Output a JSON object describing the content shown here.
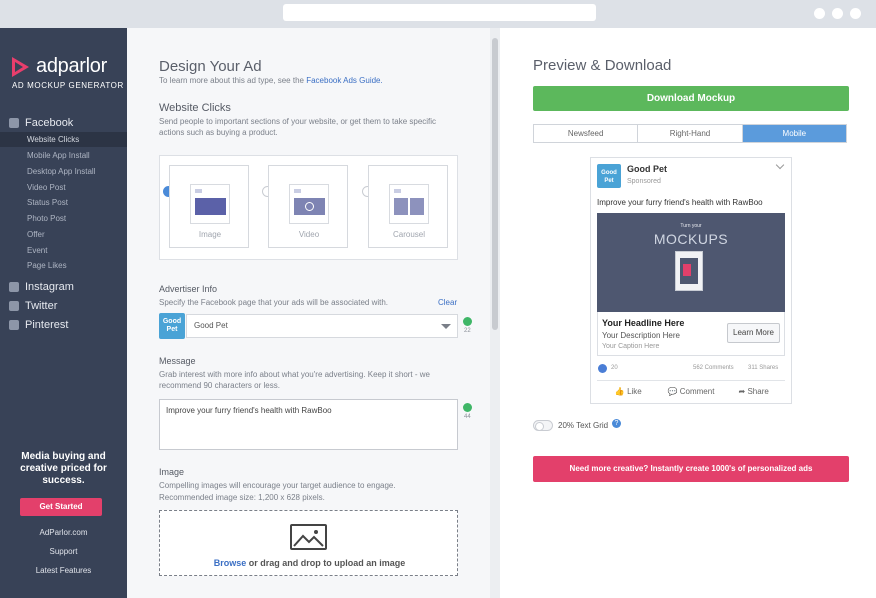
{
  "sidebar": {
    "logo_text": "adparlor",
    "logo_sub": "AD MOCKUP GENERATOR",
    "sections": [
      {
        "label": "Facebook",
        "icon": "facebook-icon"
      },
      {
        "label": "Instagram",
        "icon": "instagram-icon"
      },
      {
        "label": "Twitter",
        "icon": "twitter-icon"
      },
      {
        "label": "Pinterest",
        "icon": "pinterest-icon"
      }
    ],
    "facebook_items": [
      "Website Clicks",
      "Mobile App Install",
      "Desktop App Install",
      "Video Post",
      "Status Post",
      "Photo Post",
      "Offer",
      "Event",
      "Page Likes"
    ],
    "promo_text": "Media buying and creative priced for success.",
    "get_started": "Get Started",
    "links": [
      "AdParlor.com",
      "Support",
      "Latest Features"
    ]
  },
  "design": {
    "title": "Design Your Ad",
    "intro_prefix": "To learn more about this ad type, see the",
    "intro_link": "Facebook Ads Guide.",
    "ad_type_title": "Website Clicks",
    "ad_type_desc": "Send people to important sections of your website, or get them to take specific actions such as buying a product.",
    "formats": [
      {
        "label": "Image",
        "selected": true
      },
      {
        "label": "Video",
        "selected": false
      },
      {
        "label": "Carousel",
        "selected": false
      }
    ],
    "advertiser_title": "Advertiser Info",
    "advertiser_desc": "Specify the Facebook page that your ads will be associated with.",
    "clear_label": "Clear",
    "page_logo_text": "Good Pet",
    "page_value": "Good Pet",
    "page_char_count": "22",
    "message_title": "Message",
    "message_desc": "Grab interest with more info about what you're advertising. Keep it short - we recommend 90 characters or less.",
    "message_value": "Improve your furry friend's health with RawBoo",
    "message_char_count": "44",
    "image_title": "Image",
    "image_desc_1": "Compelling images will encourage your target audience to engage.",
    "image_desc_2": "Recommended image size: 1,200 x 628 pixels.",
    "browse_label": "Browse",
    "upload_text": " or drag and drop to upload an image"
  },
  "preview": {
    "title": "Preview & Download",
    "download_button": "Download Mockup",
    "tabs": [
      {
        "label": "Newsfeed",
        "active": false
      },
      {
        "label": "Right-Hand",
        "active": false
      },
      {
        "label": "Mobile",
        "active": true
      }
    ],
    "post": {
      "page_name": "Good Pet",
      "logo_text": "Good Pet",
      "sponsored": "Sponsored",
      "message": "Improve your furry friend's health with RawBoo",
      "image_small": "Turn your",
      "image_big": "MOCKUPS",
      "headline": "Your Headline Here",
      "description": "Your Description Here",
      "caption": "Your Caption Here",
      "cta": "Learn More",
      "likes": "20",
      "comments": "562 Comments",
      "shares": "311 Shares",
      "actions": [
        "Like",
        "Comment",
        "Share"
      ]
    },
    "grid_label": "20% Text Grid",
    "creative_button": "Need more creative? Instantly create 1000's of personalized ads"
  },
  "colors": {
    "sidebar": "#384257",
    "brand_pink": "#e3406b",
    "download_green": "#5cb85c",
    "tab_blue": "#5b9bdc"
  }
}
